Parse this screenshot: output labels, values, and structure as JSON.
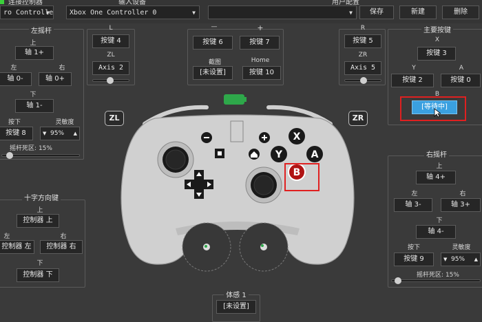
{
  "top": {
    "left_title": "连接控制器",
    "left_combo": "ro Controller",
    "mid_title": "输入设备",
    "mid_combo": "Xbox One Controller 0",
    "right_title": "用户配置",
    "save": "保存",
    "new": "新建",
    "delete": "删除"
  },
  "left_stick": {
    "title": "左摇杆",
    "up_label": "上",
    "up_value": "轴 1+",
    "left_label": "左",
    "left_value": "轴 0-",
    "right_label": "右",
    "right_value": "轴 0+",
    "down_label": "下",
    "down_value": "轴 1-",
    "press_label": "按下",
    "press_value": "按键 8",
    "sens_label": "灵敏度",
    "sens_value": "95%",
    "deadzone_label": "摇杆死区: 15%"
  },
  "l_group": {
    "l_label": "L",
    "l_value": "按键 4",
    "zl_label": "ZL",
    "zl_value": "Axis 2"
  },
  "mid_group": {
    "minus_label": "—",
    "minus_value": "按键 6",
    "plus_label": "+",
    "plus_value": "按键 7",
    "capture_label": "截图",
    "capture_value": "[未设置]",
    "home_label": "Home",
    "home_value": "按键 10"
  },
  "r_group": {
    "r_label": "R",
    "r_value": "按键 5",
    "zr_label": "ZR",
    "zr_value": "Axis 5"
  },
  "main_buttons": {
    "title": "主要按键",
    "x_label": "X",
    "x_value": "按键 3",
    "y_label": "Y",
    "y_value": "按键 2",
    "a_label": "A",
    "a_value": "按键 0",
    "b_label": "B",
    "b_value": "[等待中]"
  },
  "dpad": {
    "title": "十字方向键",
    "up_label": "上",
    "up_value": "控制器 上",
    "left_label": "左",
    "left_value": "控制器 左",
    "right_label": "右",
    "right_value": "控制器 右",
    "down_label": "下",
    "down_value": "控制器 下"
  },
  "right_stick": {
    "title": "右摇杆",
    "up_label": "上",
    "up_value": "轴 4+",
    "left_label": "左",
    "left_value": "轴 3-",
    "right_label": "右",
    "right_value": "轴 3+",
    "down_label": "下",
    "down_value": "轴 4-",
    "press_label": "按下",
    "press_value": "按键 9",
    "sens_label": "灵敏度",
    "sens_value": "95%",
    "deadzone_label": "摇杆死区: 15%"
  },
  "motion": {
    "label": "体感 1",
    "value": "[未设置]"
  },
  "controller": {
    "zl": "ZL",
    "zr": "ZR",
    "x": "X",
    "y": "Y",
    "a": "A",
    "b": "B"
  },
  "colors": {
    "accent": "#3aa0e0",
    "highlight": "#e02020",
    "battery": "#2ea84a",
    "b_button": "#b01414"
  }
}
